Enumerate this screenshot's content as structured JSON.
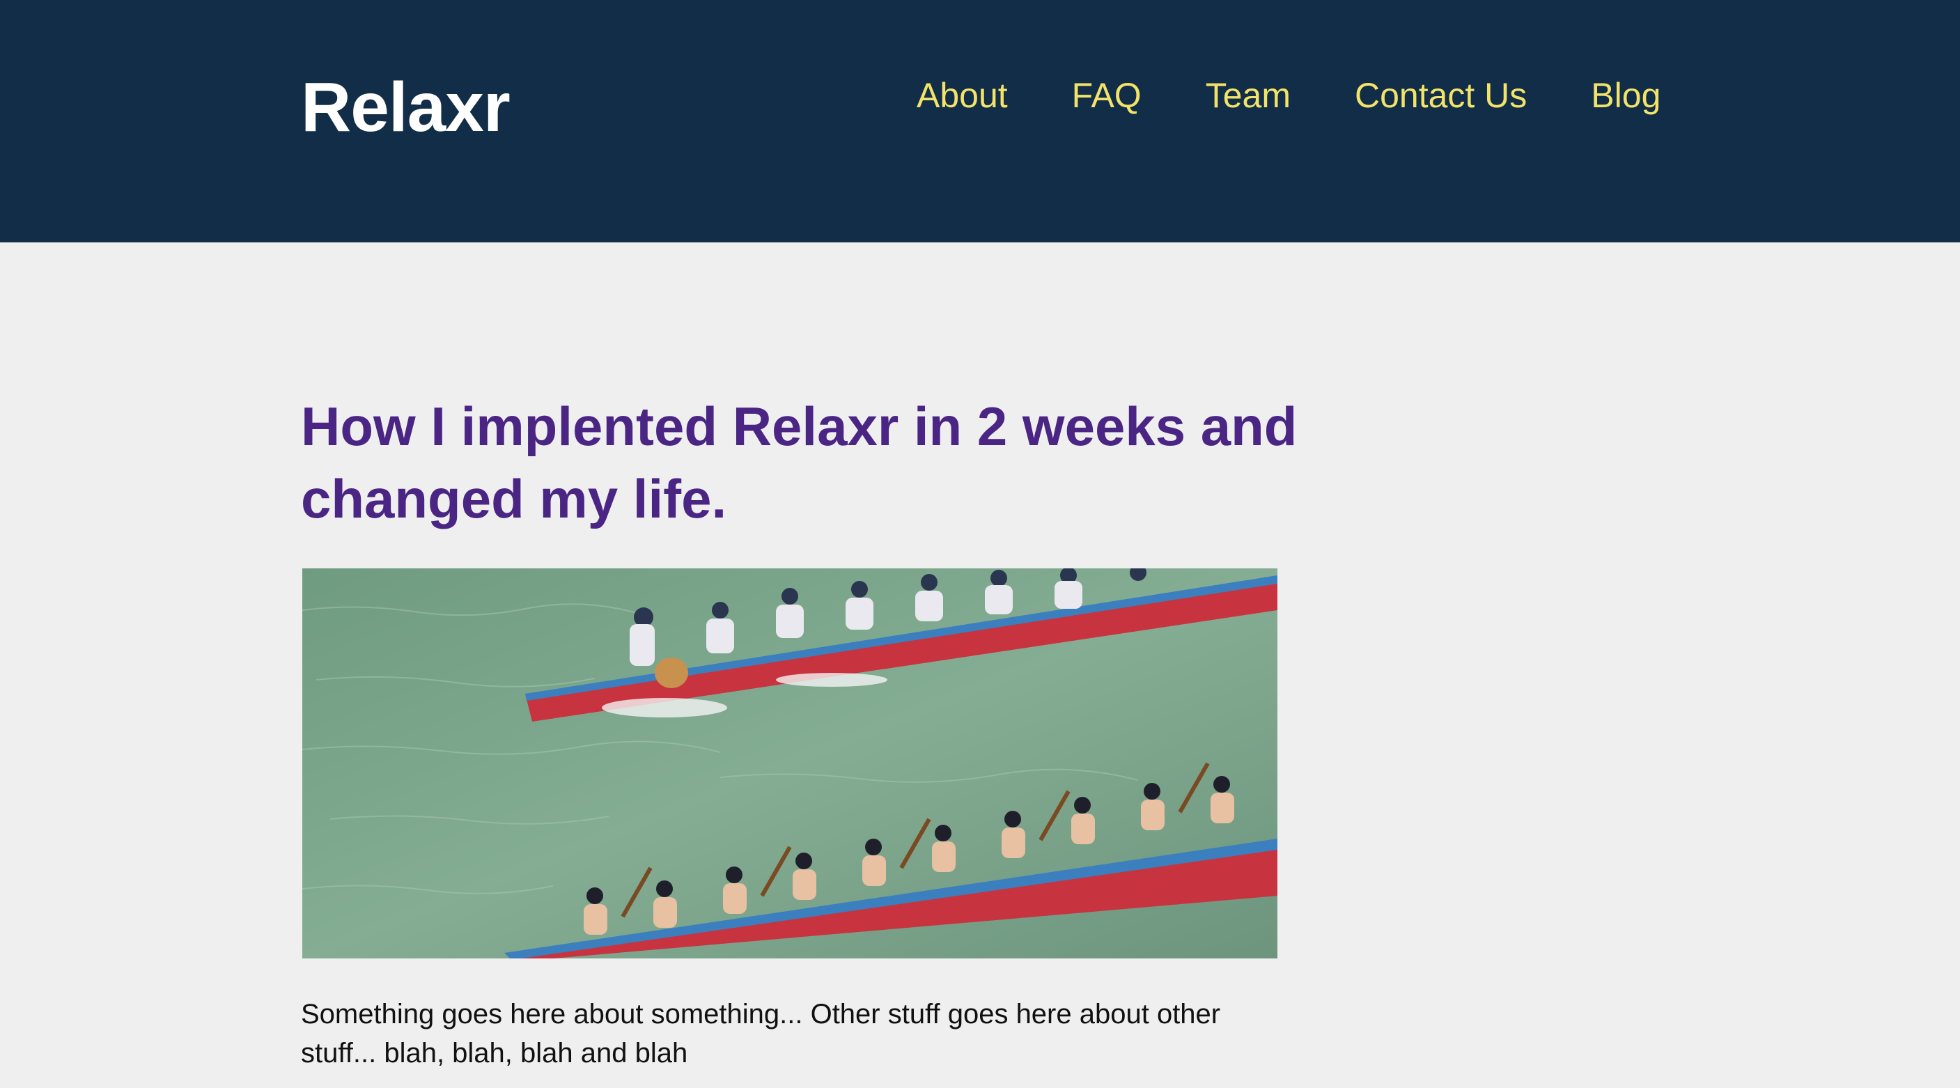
{
  "header": {
    "logo": "Relaxr",
    "nav": [
      {
        "label": "About"
      },
      {
        "label": "FAQ"
      },
      {
        "label": "Team"
      },
      {
        "label": "Contact Us"
      },
      {
        "label": "Blog"
      }
    ]
  },
  "post": {
    "title": "How I implented Relaxr in 2 weeks and changed my life.",
    "image_subject": "dragon boat race photo",
    "body": "Something goes here about something... Other stuff goes here about other stuff... blah, blah, blah and blah"
  },
  "colors": {
    "header_bg": "#112d47",
    "nav_link": "#f3e36a",
    "title": "#4b2584",
    "page_bg": "#efefef"
  }
}
